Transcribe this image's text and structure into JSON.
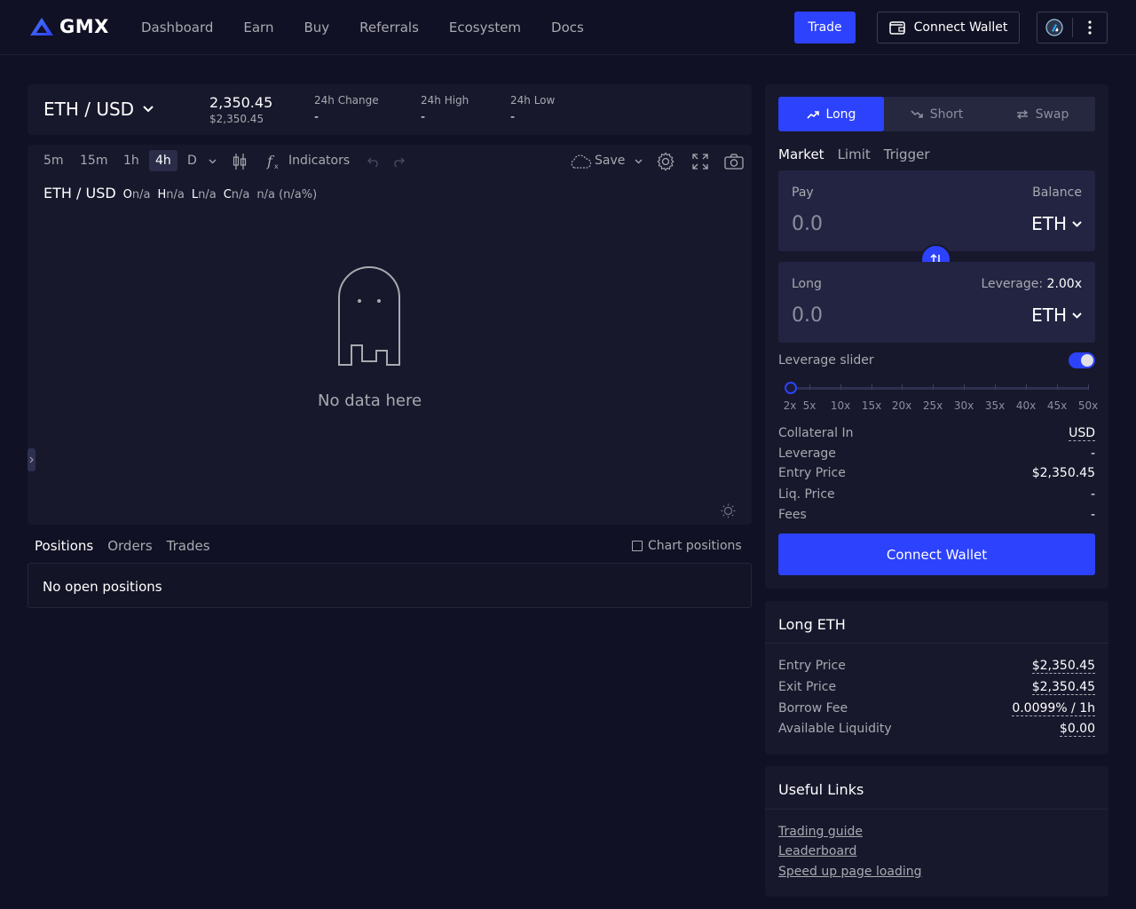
{
  "header": {
    "logo_text": "GMX",
    "nav": [
      "Dashboard",
      "Earn",
      "Buy",
      "Referrals",
      "Ecosystem",
      "Docs"
    ],
    "trade_label": "Trade",
    "connect_wallet_label": "Connect Wallet"
  },
  "ticker": {
    "pair": "ETH / USD",
    "price": "2,350.45",
    "price_usd": "$2,350.45",
    "change_label": "24h Change",
    "change_value": "-",
    "high_label": "24h High",
    "high_value": "-",
    "low_label": "24h Low",
    "low_value": "-"
  },
  "chart_toolbar": {
    "intervals": [
      "5m",
      "15m",
      "1h",
      "4h",
      "D"
    ],
    "active_interval": "4h",
    "indicators_label": "Indicators",
    "save_label": "Save"
  },
  "chart_legend": {
    "symbol": "ETH / USD",
    "o_key": "O",
    "o_val": "n/a",
    "h_key": "H",
    "h_val": "n/a",
    "l_key": "L",
    "l_val": "n/a",
    "c_key": "C",
    "c_val": "n/a",
    "change": "n/a (n/a%)"
  },
  "chart_empty": "No data here",
  "positions": {
    "tabs": [
      "Positions",
      "Orders",
      "Trades"
    ],
    "active_tab": "Positions",
    "chart_positions_label": "Chart positions",
    "empty": "No open positions"
  },
  "trade_panel": {
    "sides": [
      "Long",
      "Short",
      "Swap"
    ],
    "active_side": "Long",
    "order_types": [
      "Market",
      "Limit",
      "Trigger"
    ],
    "active_order_type": "Market",
    "pay": {
      "label": "Pay",
      "right_label": "Balance",
      "value": "0.0",
      "token": "ETH"
    },
    "long": {
      "label": "Long",
      "right_label": "Leverage: ",
      "leverage": "2.00x",
      "value": "0.0",
      "token": "ETH"
    },
    "leverage_slider_label": "Leverage slider",
    "leverage_slider_enabled": true,
    "leverage_marks": [
      "2x",
      "5x",
      "10x",
      "15x",
      "20x",
      "25x",
      "30x",
      "35x",
      "40x",
      "45x",
      "50x"
    ],
    "leverage_selected": "2x",
    "info": [
      {
        "k": "Collateral In",
        "v": "USD"
      },
      {
        "k": "Leverage",
        "v": "-"
      },
      {
        "k": "Entry Price",
        "v": "$2,350.45"
      },
      {
        "k": "Liq. Price",
        "v": "-"
      },
      {
        "k": "Fees",
        "v": "-"
      }
    ],
    "connect_label": "Connect Wallet"
  },
  "long_card": {
    "title": "Long ETH",
    "rows": [
      {
        "k": "Entry Price",
        "v": "$2,350.45"
      },
      {
        "k": "Exit Price",
        "v": "$2,350.45"
      },
      {
        "k": "Borrow Fee",
        "v": "0.0099% / 1h"
      },
      {
        "k": "Available Liquidity",
        "v": "$0.00"
      }
    ]
  },
  "links_card": {
    "title": "Useful Links",
    "links": [
      "Trading guide",
      "Leaderboard",
      "Speed up page loading"
    ]
  },
  "colors": {
    "background": "#101124",
    "panel": "#17182c",
    "accent": "#2d42fc",
    "muted_text": "#a9a9b0"
  }
}
